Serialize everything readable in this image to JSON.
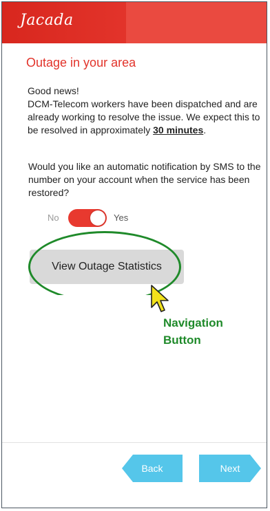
{
  "header": {
    "logo_text": "Jacada"
  },
  "page_title": "Outage in your area",
  "message": {
    "line1": "Good news!",
    "body": "DCM-Telecom workers have been dispatched and are already working to resolve the issue. We expect this to be resolved in approximately ",
    "eta": "30 minutes",
    "end": "."
  },
  "question": "Would you like an automatic notification by SMS to the number on your account when the service has been restored?",
  "toggle": {
    "off_label": "No",
    "on_label": "Yes",
    "state": "on"
  },
  "stats_button": {
    "label": "View Outage Statistics"
  },
  "annotation": {
    "line1": "Navigation",
    "line2": "Button"
  },
  "nav": {
    "back_label": "Back",
    "next_label": "Next"
  },
  "colors": {
    "brand_red": "#e2332a",
    "nav_blue": "#55c6ea",
    "annotation_green": "#1f8a2a"
  }
}
